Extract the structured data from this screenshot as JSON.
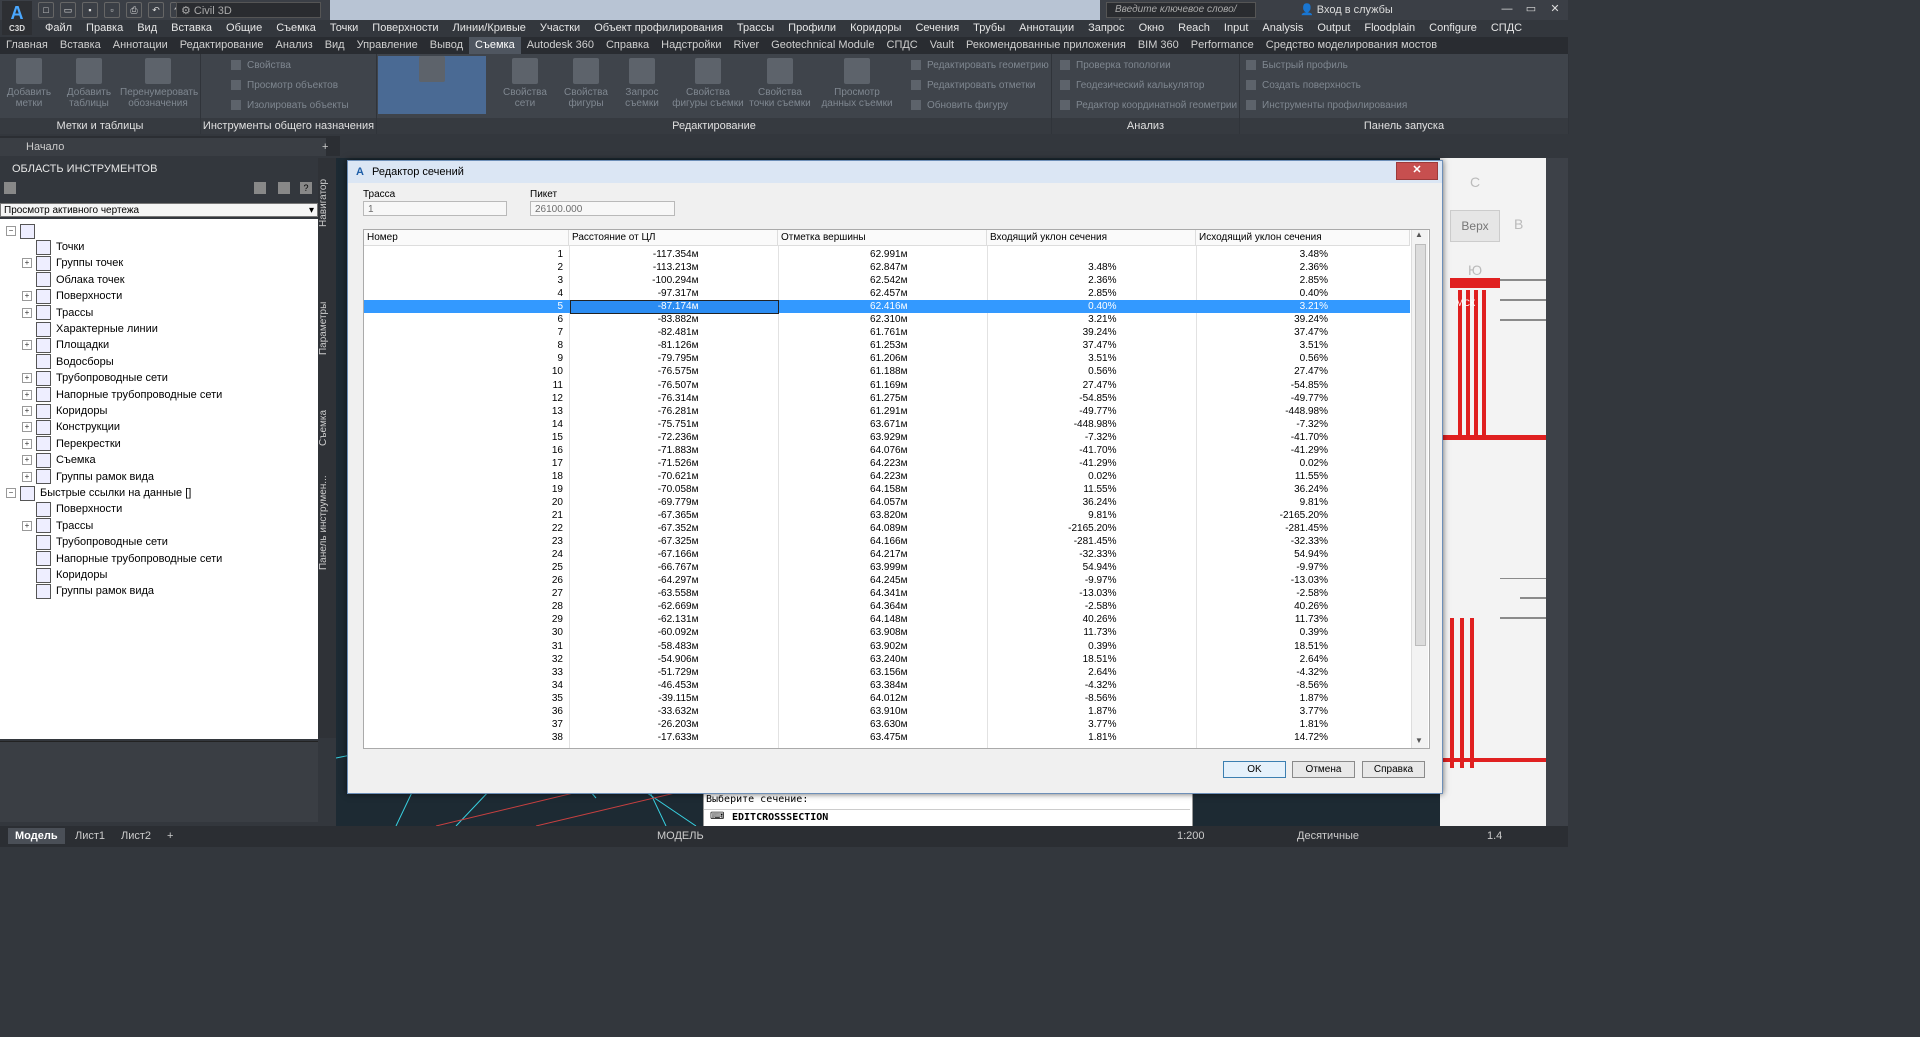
{
  "app": {
    "logo": "A",
    "logo_sub": "C3D",
    "workspace": "Civil 3D",
    "search_placeholder": "Введите ключевое слово/фразу",
    "login": "Вход в службы"
  },
  "menubar": [
    "Файл",
    "Правка",
    "Вид",
    "Вставка",
    "Общие",
    "Съемка",
    "Точки",
    "Поверхности",
    "Линии/Кривые",
    "Участки",
    "Объект профилирования",
    "Трассы",
    "Профили",
    "Коридоры",
    "Сечения",
    "Трубы",
    "Аннотации",
    "Запрос",
    "Окно",
    "Reach",
    "Input",
    "Analysis",
    "Output",
    "Floodplain",
    "Configure",
    "СПДС"
  ],
  "ribbon_tabs": [
    "Главная",
    "Вставка",
    "Аннотации",
    "Редактирование",
    "Анализ",
    "Вид",
    "Управление",
    "Вывод",
    "Съемка",
    "Autodesk 360",
    "Справка",
    "Надстройки",
    "River",
    "Geotechnical Module",
    "СПДС",
    "Vault",
    "Рекомендованные приложения",
    "BIM 360",
    "Performance",
    "Средство моделирования мостов"
  ],
  "ribbon_active_tab": "Съемка",
  "ribbon": {
    "groups": [
      {
        "title": "Метки и таблицы",
        "big": [
          "Добавить метки",
          "Добавить таблицы",
          "Перенумеровать обозначения"
        ]
      },
      {
        "title": "Инструменты общего назначения",
        "small": [
          "Свойства",
          "Просмотр объектов",
          "Изолировать объекты"
        ]
      },
      {
        "title": "Редактирование",
        "big": [
          "Свойства сети",
          "Свойства фигуры",
          "Запрос съемки",
          "Свойства фигуры съемки",
          "Свойства точки съемки",
          "Просмотр данных съемки"
        ],
        "small": [
          "Редактировать геометрию",
          "Редактировать отметки",
          "Обновить фигуру"
        ]
      },
      {
        "title": "Анализ",
        "small": [
          "Проверка топологии",
          "Геодезический калькулятор",
          "Редактор координатной геометрии"
        ]
      },
      {
        "title": "Панель запуска",
        "small": [
          "Быстрый профиль",
          "Создать поверхность",
          "Инструменты профилирования"
        ]
      }
    ]
  },
  "doc_tabs": [
    "Начало"
  ],
  "toolspace": {
    "title": "ОБЛАСТЬ ИНСТРУМЕНТОВ",
    "view_select": "Просмотр активного чертежа",
    "tree": [
      {
        "label": "Точки",
        "level": 1,
        "exp": false
      },
      {
        "label": "Группы точек",
        "level": 1,
        "exp": true
      },
      {
        "label": "Облака точек",
        "level": 1,
        "exp": false
      },
      {
        "label": "Поверхности",
        "level": 1,
        "exp": true
      },
      {
        "label": "Трассы",
        "level": 1,
        "exp": true
      },
      {
        "label": "Характерные линии",
        "level": 1,
        "exp": false
      },
      {
        "label": "Площадки",
        "level": 1,
        "exp": true
      },
      {
        "label": "Водосборы",
        "level": 1,
        "exp": false
      },
      {
        "label": "Трубопроводные сети",
        "level": 1,
        "exp": true
      },
      {
        "label": "Напорные трубопроводные сети",
        "level": 1,
        "exp": true
      },
      {
        "label": "Коридоры",
        "level": 1,
        "exp": true
      },
      {
        "label": "Конструкции",
        "level": 1,
        "exp": true
      },
      {
        "label": "Перекрестки",
        "level": 1,
        "exp": true
      },
      {
        "label": "Съемка",
        "level": 1,
        "exp": true
      },
      {
        "label": "Группы рамок вида",
        "level": 1,
        "exp": true
      },
      {
        "label": "Быстрые ссылки на данные []",
        "level": 0,
        "exp": true
      },
      {
        "label": "Поверхности",
        "level": 1,
        "exp": false
      },
      {
        "label": "Трассы",
        "level": 1,
        "exp": true
      },
      {
        "label": "Трубопроводные сети",
        "level": 1,
        "exp": false
      },
      {
        "label": "Напорные трубопроводные сети",
        "level": 1,
        "exp": false
      },
      {
        "label": "Коридоры",
        "level": 1,
        "exp": false
      },
      {
        "label": "Группы рамок вида",
        "level": 1,
        "exp": false
      }
    ],
    "vtabs": [
      "Навигатор",
      "Параметры",
      "Съемка",
      "Панель инструмен..."
    ]
  },
  "viewcube": {
    "top": "Верх",
    "c": "С",
    "b": "В",
    "z": "Ю",
    "wcs": "МСК"
  },
  "command_line": {
    "prompt": "Выберите сечение:",
    "input": "EDITCROSSSECTION"
  },
  "layout_tabs": [
    "Модель",
    "Лист1",
    "Лист2"
  ],
  "status": {
    "model": "МОДЕЛЬ",
    "scale": "1:200",
    "units": "Десятичные",
    "zoom": "1.4"
  },
  "dialog": {
    "title": "Редактор сечений",
    "close": "✕",
    "alignment_label": "Трасса",
    "alignment_value": "1",
    "station_label": "Пикет",
    "station_value": "26100.000",
    "columns": [
      "Номер",
      "Расстояние от ЦЛ",
      "Отметка вершины",
      "Входящий уклон сечения",
      "Исходящий уклон сечения"
    ],
    "selected_row": 5,
    "rows": [
      [
        "1",
        "-117.354м",
        "62.991м",
        "",
        "3.48%"
      ],
      [
        "2",
        "-113.213м",
        "62.847м",
        "3.48%",
        "2.36%"
      ],
      [
        "3",
        "-100.294м",
        "62.542м",
        "2.36%",
        "2.85%"
      ],
      [
        "4",
        "-97.317м",
        "62.457м",
        "2.85%",
        "0.40%"
      ],
      [
        "5",
        "-87.174м",
        "62.416м",
        "0.40%",
        "3.21%"
      ],
      [
        "6",
        "-83.882м",
        "62.310м",
        "3.21%",
        "39.24%"
      ],
      [
        "7",
        "-82.481м",
        "61.761м",
        "39.24%",
        "37.47%"
      ],
      [
        "8",
        "-81.126м",
        "61.253м",
        "37.47%",
        "3.51%"
      ],
      [
        "9",
        "-79.795м",
        "61.206м",
        "3.51%",
        "0.56%"
      ],
      [
        "10",
        "-76.575м",
        "61.188м",
        "0.56%",
        "27.47%"
      ],
      [
        "11",
        "-76.507м",
        "61.169м",
        "27.47%",
        "-54.85%"
      ],
      [
        "12",
        "-76.314м",
        "61.275м",
        "-54.85%",
        "-49.77%"
      ],
      [
        "13",
        "-76.281м",
        "61.291м",
        "-49.77%",
        "-448.98%"
      ],
      [
        "14",
        "-75.751м",
        "63.671м",
        "-448.98%",
        "-7.32%"
      ],
      [
        "15",
        "-72.236м",
        "63.929м",
        "-7.32%",
        "-41.70%"
      ],
      [
        "16",
        "-71.883м",
        "64.076м",
        "-41.70%",
        "-41.29%"
      ],
      [
        "17",
        "-71.526м",
        "64.223м",
        "-41.29%",
        "0.02%"
      ],
      [
        "18",
        "-70.621м",
        "64.223м",
        "0.02%",
        "11.55%"
      ],
      [
        "19",
        "-70.058м",
        "64.158м",
        "11.55%",
        "36.24%"
      ],
      [
        "20",
        "-69.779м",
        "64.057м",
        "36.24%",
        "9.81%"
      ],
      [
        "21",
        "-67.365м",
        "63.820м",
        "9.81%",
        "-2165.20%"
      ],
      [
        "22",
        "-67.352м",
        "64.089м",
        "-2165.20%",
        "-281.45%"
      ],
      [
        "23",
        "-67.325м",
        "64.166м",
        "-281.45%",
        "-32.33%"
      ],
      [
        "24",
        "-67.166м",
        "64.217м",
        "-32.33%",
        "54.94%"
      ],
      [
        "25",
        "-66.767м",
        "63.999м",
        "54.94%",
        "-9.97%"
      ],
      [
        "26",
        "-64.297м",
        "64.245м",
        "-9.97%",
        "-13.03%"
      ],
      [
        "27",
        "-63.558м",
        "64.341м",
        "-13.03%",
        "-2.58%"
      ],
      [
        "28",
        "-62.669м",
        "64.364м",
        "-2.58%",
        "40.26%"
      ],
      [
        "29",
        "-62.131м",
        "64.148м",
        "40.26%",
        "11.73%"
      ],
      [
        "30",
        "-60.092м",
        "63.908м",
        "11.73%",
        "0.39%"
      ],
      [
        "31",
        "-58.483м",
        "63.902м",
        "0.39%",
        "18.51%"
      ],
      [
        "32",
        "-54.906м",
        "63.240м",
        "18.51%",
        "2.64%"
      ],
      [
        "33",
        "-51.729м",
        "63.156м",
        "2.64%",
        "-4.32%"
      ],
      [
        "34",
        "-46.453м",
        "63.384м",
        "-4.32%",
        "-8.56%"
      ],
      [
        "35",
        "-39.115м",
        "64.012м",
        "-8.56%",
        "1.87%"
      ],
      [
        "36",
        "-33.632м",
        "63.910м",
        "1.87%",
        "3.77%"
      ],
      [
        "37",
        "-26.203м",
        "63.630м",
        "3.77%",
        "1.81%"
      ],
      [
        "38",
        "-17.633м",
        "63.475м",
        "1.81%",
        "14.72%"
      ]
    ],
    "ok": "OK",
    "cancel": "Отмена",
    "help": "Справка"
  }
}
